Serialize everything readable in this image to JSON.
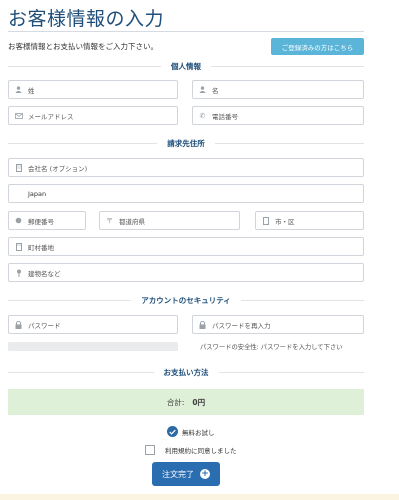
{
  "header": {
    "title": "お客様情報の入力",
    "intro": "お客様情報とお支払い情報をご入力下さい。",
    "login_button": "ご登録済みの方はこちら"
  },
  "personal": {
    "heading": "個人情報",
    "last_name_placeholder": "姓",
    "first_name_placeholder": "名",
    "email_placeholder": "メールアドレス",
    "phone_placeholder": "電話番号"
  },
  "billing": {
    "heading": "請求先住所",
    "company_placeholder": "会社名 (オプション)",
    "country_value": "Japan",
    "postal_placeholder": "郵便番号",
    "prefecture_placeholder": "都道府県",
    "city_placeholder": "市・区",
    "street_placeholder": "町村番地",
    "building_placeholder": "建物名など"
  },
  "security": {
    "heading": "アカウントのセキュリティ",
    "password_placeholder": "パスワード",
    "password_confirm_placeholder": "パスワードを再入力",
    "strength_text": "パスワードの安全性: パスワードを入力して下さい",
    "strength_level": 0
  },
  "payment": {
    "heading": "お支払い方法",
    "total_label": "合計:",
    "total_amount": "0円",
    "free_trial_label": "無料お試し",
    "free_trial_checked": true,
    "terms_label": "利用規約に同意しました",
    "terms_checked": false,
    "submit_label": "注文完了"
  },
  "colors": {
    "title": "#1f4e79",
    "login_button": "#5bb5d9",
    "total_bg": "#dff0d8",
    "submit_button": "#2a6db0"
  }
}
